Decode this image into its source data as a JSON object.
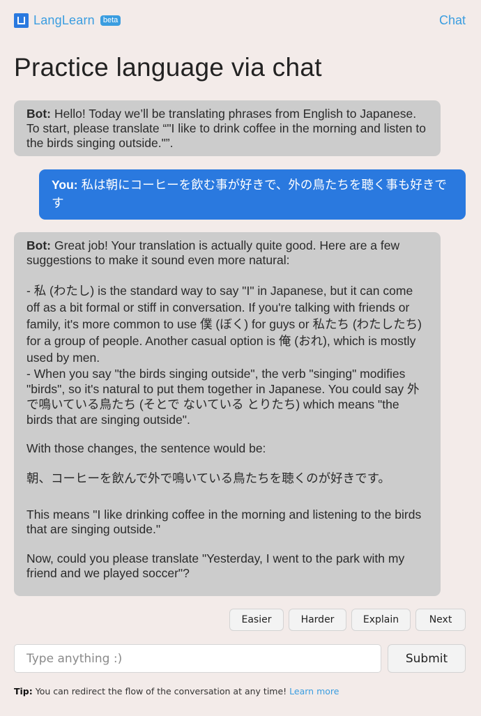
{
  "header": {
    "brand": "LangLearn",
    "badge": "beta",
    "nav_link": "Chat",
    "logo_icon": "layout-square-icon",
    "brand_color": "#3a9de0"
  },
  "page": {
    "title": "Practice language via chat"
  },
  "messages": [
    {
      "sender": "Bot:",
      "text": "Hello! Today we’ll be translating phrases from English to Japanese. To start, please translate “\"I like to drink coffee in the morning and listen to the birds singing outside.\"”."
    },
    {
      "sender": "You:",
      "text": "私は朝にコーヒーを飲む事が好きで、外の鳥たちを聴く事も好きです"
    },
    {
      "sender": "Bot:",
      "intro": "Great job! Your translation is actually quite good. Here are a few suggestions to make it sound even more natural:",
      "point1": "- 私 (わたし) is the standard way to say \"I\" in Japanese, but it can come off as a bit formal or stiff in conversation. If you're talking with friends or family, it's more common to use 僕 (ぼく) for guys or 私たち (わたしたち) for a group of people. Another casual option is 俺 (おれ), which is mostly used by men.",
      "point2": "- When you say \"the birds singing outside\", the verb \"singing\" modifies \"birds\", so it's natural to put them together in Japanese. You could say 外で鳴いている鳥たち (そとで ないている とりたち) which means \"the birds that are singing outside\".",
      "lead": "With those changes, the sentence would be:",
      "sentence": "朝、コーヒーを飲んで外で鳴いている鳥たちを聴くのが好きです。",
      "meaning": "This means \"I like drinking coffee in the morning and listening to the birds that are singing outside.\"",
      "next": "Now, could you please translate \"Yesterday, I went to the park with my friend and we played soccer\"?"
    }
  ],
  "actions": [
    "Easier",
    "Harder",
    "Explain",
    "Next"
  ],
  "composer": {
    "placeholder": "Type anything :)",
    "value": "",
    "submit_label": "Submit"
  },
  "tip": {
    "label": "Tip:",
    "text": "You can redirect the flow of the conversation at any time!",
    "link": "Learn more"
  },
  "colors": {
    "bot_bubble": "#cccccc",
    "user_bubble": "#2a79df",
    "background": "#f3ebe9"
  }
}
